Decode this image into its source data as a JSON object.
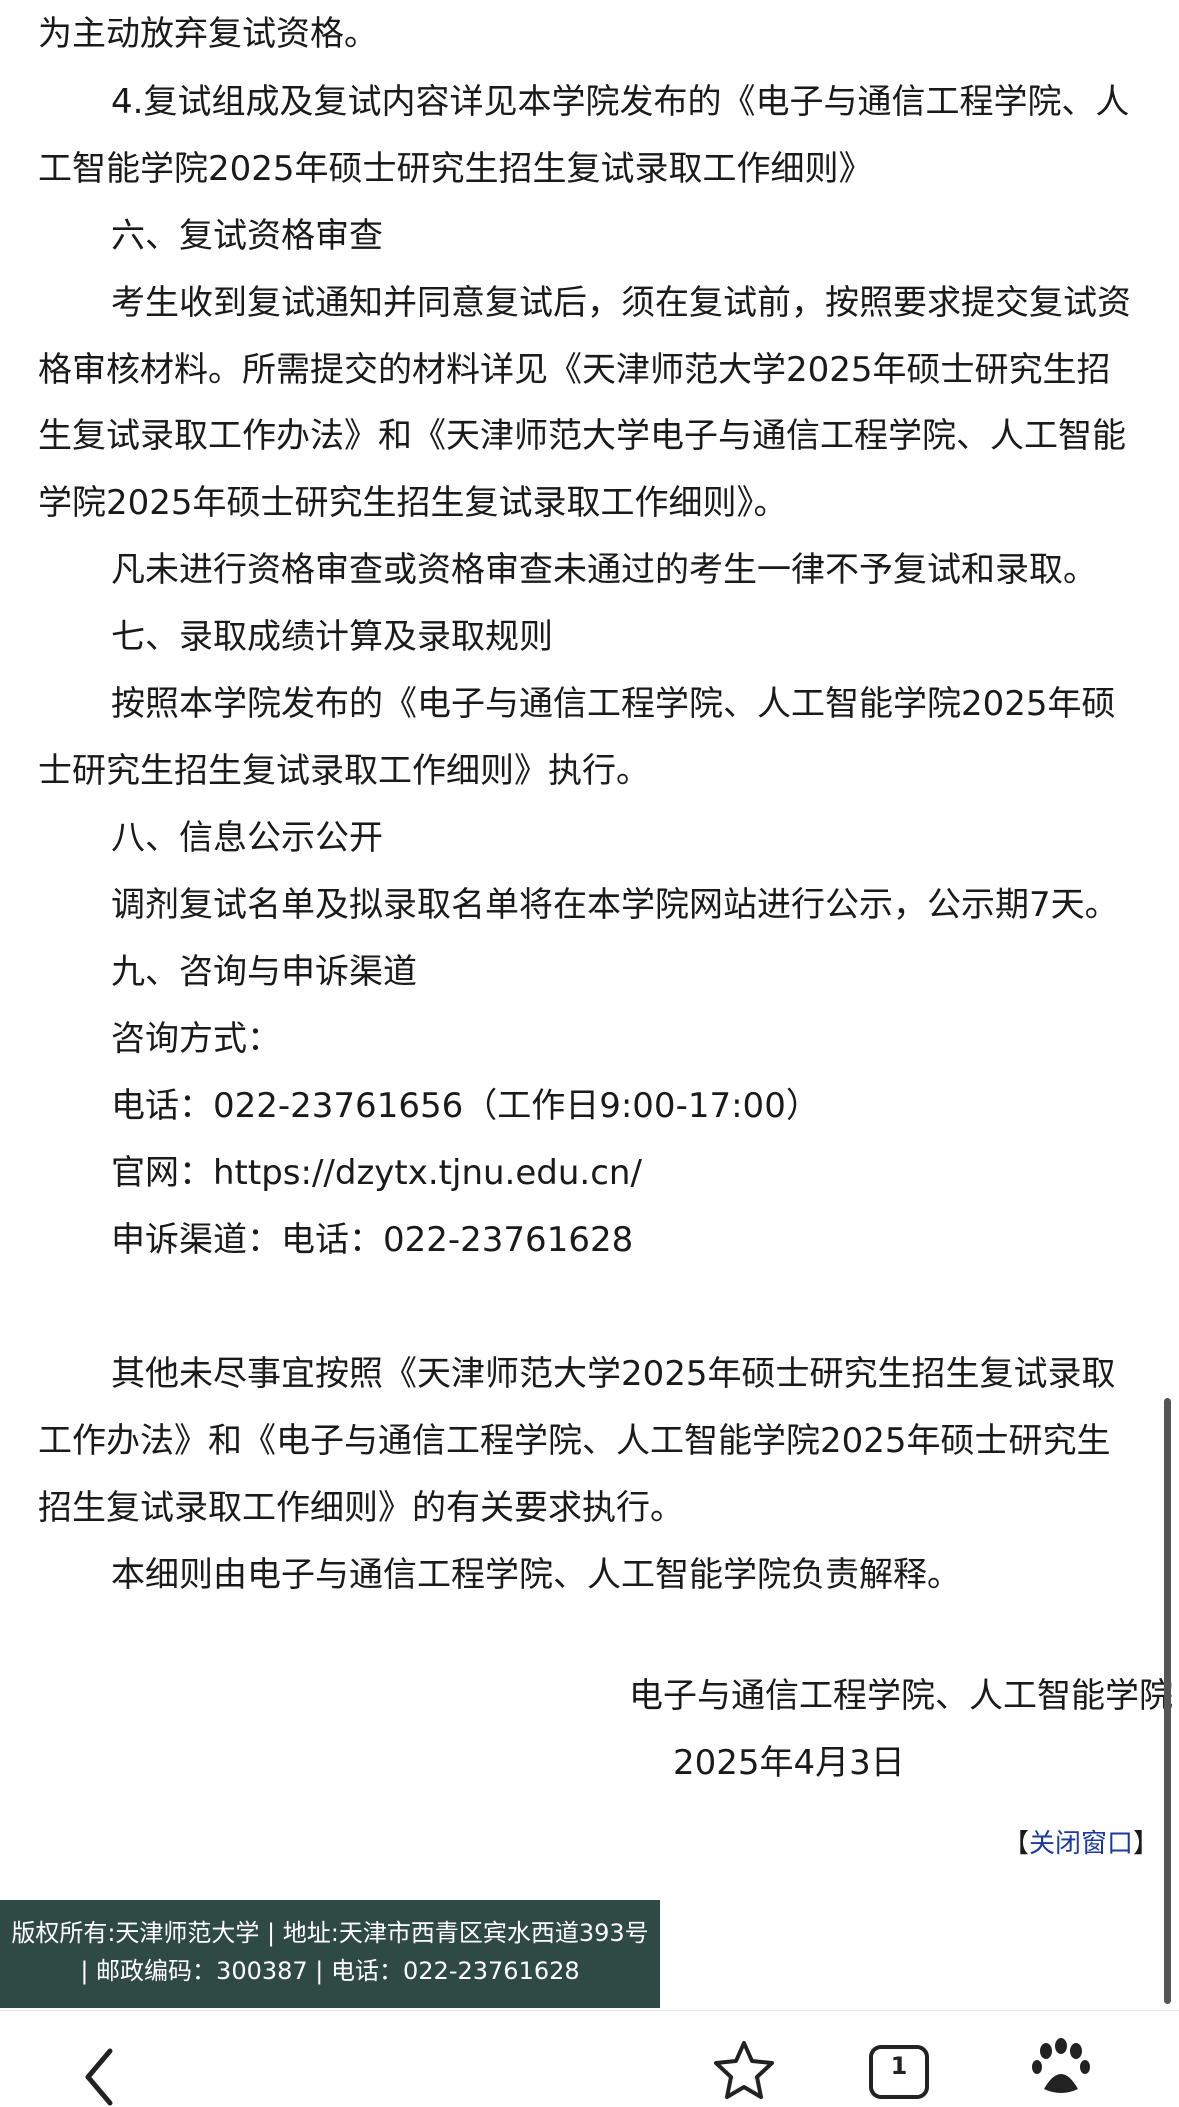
{
  "article": {
    "lines": [
      "为主动放弃复试资格。",
      "4.复试组成及复试内容详见本学院发布的《电子与通信工程学院、人",
      "工智能学院2025年硕士研究生招生复试录取工作细则》",
      "六、复试资格审查",
      "考生收到复试通知并同意复试后，须在复试前，按照要求提交复试资",
      "格审核材料。所需提交的材料详见《天津师范大学2025年硕士研究生招",
      "生复试录取工作办法》和《天津师范大学电子与通信工程学院、人工智能",
      "学院2025年硕士研究生招生复试录取工作细则》。",
      "凡未进行资格审查或资格审查未通过的考生一律不予复试和录取。",
      "七、录取成绩计算及录取规则",
      "按照本学院发布的《电子与通信工程学院、人工智能学院2025年硕",
      "士研究生招生复试录取工作细则》执行。",
      "八、信息公示公开",
      "调剂复试名单及拟录取名单将在本学院网站进行公示，公示期7天。",
      "九、咨询与申诉渠道",
      "咨询方式：",
      "电话：022-23761656（工作日9:00-17:00）",
      "官网：https://dzytx.tjnu.edu.cn/",
      "申诉渠道：电话：022-23761628",
      "其他未尽事宜按照《天津师范大学2025年硕士研究生招生复试录取",
      "工作办法》和《电子与通信工程学院、人工智能学院2025年硕士研究生",
      "招生复试录取工作细则》的有关要求执行。",
      "本细则由电子与通信工程学院、人工智能学院负责解释。"
    ]
  },
  "signature": {
    "org": "电子与通信工程学院、人工智能学院",
    "date": "2025年4月3日"
  },
  "close_window": {
    "bracket_open": "【",
    "label": "关闭窗口",
    "bracket_close": "】"
  },
  "footer": {
    "line1": "版权所有:天津师范大学 | 地址:天津市西青区宾水西道393号",
    "line2": "| 邮政编码：300387 | 电话：022-23761628"
  },
  "toolbar": {
    "tab_count": "1",
    "icons": [
      "back-icon",
      "star-icon",
      "tabs-icon",
      "paw-icon"
    ]
  }
}
